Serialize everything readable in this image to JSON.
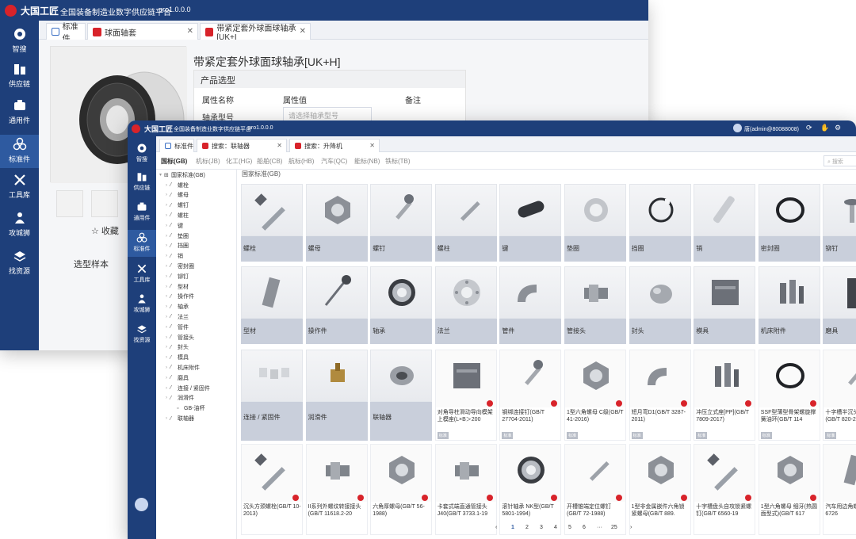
{
  "app": {
    "brand": "大国工匠",
    "title": "全国装备制造业数字供应链平台",
    "version": "pro1.0.0.0"
  },
  "user": {
    "name": "唐(admin@80088008)"
  },
  "sidebar": {
    "items": [
      {
        "label": "智搜",
        "icon": "smart-search-icon"
      },
      {
        "label": "供应链",
        "icon": "supply-chain-icon"
      },
      {
        "label": "通用件",
        "icon": "common-parts-icon"
      },
      {
        "label": "标准件",
        "icon": "standard-parts-icon"
      },
      {
        "label": "工具库",
        "icon": "tool-library-icon"
      },
      {
        "label": "攻城狮",
        "icon": "engineer-icon"
      },
      {
        "label": "找资源",
        "icon": "find-resource-icon"
      }
    ]
  },
  "back_window": {
    "tabs": [
      {
        "label": "标准件",
        "closable": false
      },
      {
        "label": "球面轴套",
        "closable": true
      },
      {
        "label": "带紧定套外球面球轴承[UK+I",
        "closable": true
      }
    ],
    "product_title": "带紧定套外球面球轴承[UK+H]",
    "favorite_label": "☆ 收藏",
    "sample_label": "选型样本",
    "selection": {
      "header": "产品选型",
      "col_attr_name": "属性名称",
      "col_attr_value": "属性值",
      "col_note": "备注",
      "row_label": "轴承型号",
      "row_placeholder": "请选择轴承型号"
    }
  },
  "front_window": {
    "tabs": [
      {
        "label": "标准件",
        "closable": false
      },
      {
        "label": "搜索：联轴器",
        "closable": true
      },
      {
        "label": "搜索：升降机",
        "closable": true
      }
    ],
    "standards": [
      {
        "label": "国标(GB)",
        "active": true
      },
      {
        "label": "机标(JB)",
        "active": false
      },
      {
        "label": "化工(HG)",
        "active": false
      },
      {
        "label": "船舶(CB)",
        "active": false
      },
      {
        "label": "航标(HB)",
        "active": false
      },
      {
        "label": "汽车(QC)",
        "active": false
      },
      {
        "label": "能标(NB)",
        "active": false
      },
      {
        "label": "铁标(TB)",
        "active": false
      }
    ],
    "search_placeholder": "搜索",
    "tree": {
      "root": "国家标准(GB)",
      "children": [
        "螺栓",
        "螺母",
        "螺钉",
        "螺柱",
        "键",
        "垫圈",
        "挡圈",
        "销",
        "密封圈",
        "铆钉",
        "型材",
        "操作件",
        "轴承",
        "法兰",
        "管件",
        "管接头",
        "封头",
        "模具",
        "机床附件",
        "磨具",
        "连接 / 紧固件",
        "润滑件"
      ],
      "leaf": "GB-油杯",
      "last": "联轴器"
    },
    "breadcrumb": "国家标准(GB)",
    "categories": [
      "螺栓",
      "螺母",
      "螺钉",
      "螺柱",
      "键",
      "垫圈",
      "挡圈",
      "销",
      "密封圈",
      "铆钉",
      "型材",
      "操作件",
      "轴承",
      "法兰",
      "管件",
      "管接头",
      "封头",
      "模具",
      "机床附件",
      "磨具",
      "连接 / 紧固件",
      "润滑件",
      "联轴器"
    ],
    "products": [
      {
        "label": "对角导柱滑动导向模架上模座(L×B＞200",
        "badge": "标准"
      },
      {
        "label": "钢绑连接钉(GB/T 27704-2011)",
        "badge": "标准"
      },
      {
        "label": "1型六角螺母 C级(GB/T 41-2016)",
        "badge": "标准"
      },
      {
        "label": "短月弯D1(GB/T 3287-2011)",
        "badge": "标准"
      },
      {
        "label": "冲压立式座[PP](GB/T 7809-2017)",
        "badge": "标准"
      },
      {
        "label": "SSF型薄型骨架螺旋撑簧油环(GB/T 114",
        "badge": "标准"
      },
      {
        "label": "十字槽半沉头螺钉(GB/T 820-2",
        "badge": "标准"
      },
      {
        "label": "沉头方颈螺栓(GB/T 10-2013)",
        "badge": ""
      },
      {
        "label": "II系列外螺纹转接接头(GB/T 11618.2-20",
        "badge": ""
      },
      {
        "label": "六角厚螺母(GB/T 56-1988)",
        "badge": ""
      },
      {
        "label": "卡套式端直通管接头J40(GB/T 3733.1-19",
        "badge": ""
      },
      {
        "label": "滚针轴承 NK型(GB/T 5801-1994)",
        "badge": ""
      },
      {
        "label": "开槽锥端定位螺钉(GB/T 72-1988)",
        "badge": ""
      },
      {
        "label": "1型非金属嵌件六角锁紧螺母(GB/T 889.",
        "badge": ""
      },
      {
        "label": "十字槽盘头自攻锁紧螺钉(GB/T 6560-19",
        "badge": ""
      },
      {
        "label": "1型六角螺母 细牙(热圆面型式)(GB/T 617",
        "badge": ""
      },
      {
        "label": "汽车用边角螺母(GB/T 6726",
        "badge": ""
      }
    ],
    "pager": [
      "1",
      "2",
      "3",
      "4",
      "5",
      "6",
      "···",
      "25"
    ],
    "pager_prev": "‹",
    "pager_next": "›",
    "pager_active": "1"
  },
  "colors": {
    "nav": "#1e3f7a",
    "nav_active": "#2e5aa0",
    "category_label_bg": "#c9cfdb",
    "accent_red": "#d8232a"
  }
}
